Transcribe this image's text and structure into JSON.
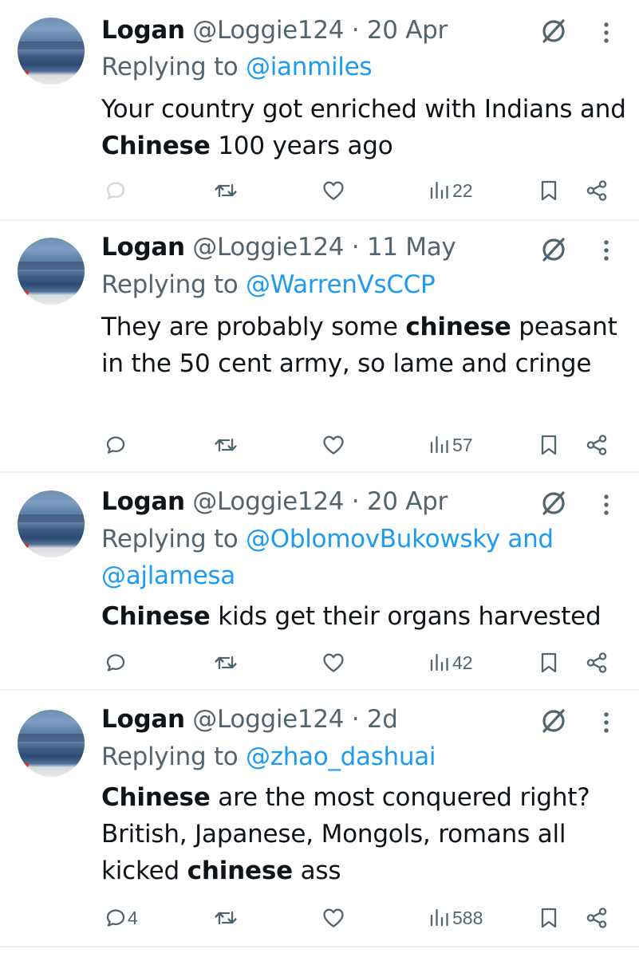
{
  "tweets": [
    {
      "name": "Logan",
      "handle": "@Loggie124",
      "separator": " · ",
      "time": "20 Apr",
      "replying_prefix": "Replying to ",
      "replying_to": [
        "@ianmiles"
      ],
      "replying_joiner": "",
      "text_parts": [
        {
          "text": "Your country got enriched with Indians and ",
          "bold": false
        },
        {
          "text": "Chinese",
          "bold": true
        },
        {
          "text": " 100 years ago",
          "bold": false
        }
      ],
      "replies": "",
      "reposts": "",
      "likes": "",
      "views": "22"
    },
    {
      "name": "Logan",
      "handle": "@Loggie124",
      "separator": " · ",
      "time": "11 May",
      "replying_prefix": "Replying to ",
      "replying_to": [
        "@WarrenVsCCP"
      ],
      "replying_joiner": "",
      "text_parts": [
        {
          "text": "They are probably some ",
          "bold": false
        },
        {
          "text": "chinese",
          "bold": true
        },
        {
          "text": " peasant in the 50 cent army, so lame and cringe",
          "bold": false
        }
      ],
      "replies": "",
      "reposts": "",
      "likes": "",
      "views": "57"
    },
    {
      "name": "Logan",
      "handle": "@Loggie124",
      "separator": " · ",
      "time": "20 Apr",
      "replying_prefix": "Replying to ",
      "replying_to": [
        "@OblomovBukowsky",
        "@ajlamesa"
      ],
      "replying_joiner": " and ",
      "text_parts": [
        {
          "text": "Chinese",
          "bold": true
        },
        {
          "text": " kids get their organs harvested",
          "bold": false
        }
      ],
      "replies": "",
      "reposts": "",
      "likes": "",
      "views": "42"
    },
    {
      "name": "Logan",
      "handle": "@Loggie124",
      "separator": " · ",
      "time": "2d",
      "replying_prefix": "Replying to ",
      "replying_to": [
        "@zhao_dashuai"
      ],
      "replying_joiner": "",
      "text_parts": [
        {
          "text": "Chinese",
          "bold": true
        },
        {
          "text": " are the most conquered right? British, Japanese, Mongols, romans all kicked ",
          "bold": false
        },
        {
          "text": "chinese",
          "bold": true
        },
        {
          "text": " ass",
          "bold": false
        }
      ],
      "replies": "4",
      "reposts": "",
      "likes": "",
      "views": "588"
    }
  ],
  "icons": {
    "reply": "reply-bubble-icon",
    "repost": "repost-icon",
    "like": "heart-icon",
    "views": "views-bar-chart-icon",
    "bookmark": "bookmark-icon",
    "share": "share-icon",
    "grok": "grok-slash-icon",
    "more": "vertical-dots-icon"
  },
  "colors": {
    "text": "#0f1419",
    "secondary": "#536471",
    "link": "#1d9bf0",
    "divider": "#eff3f4",
    "first_reply_icon": "#cfd9de"
  }
}
